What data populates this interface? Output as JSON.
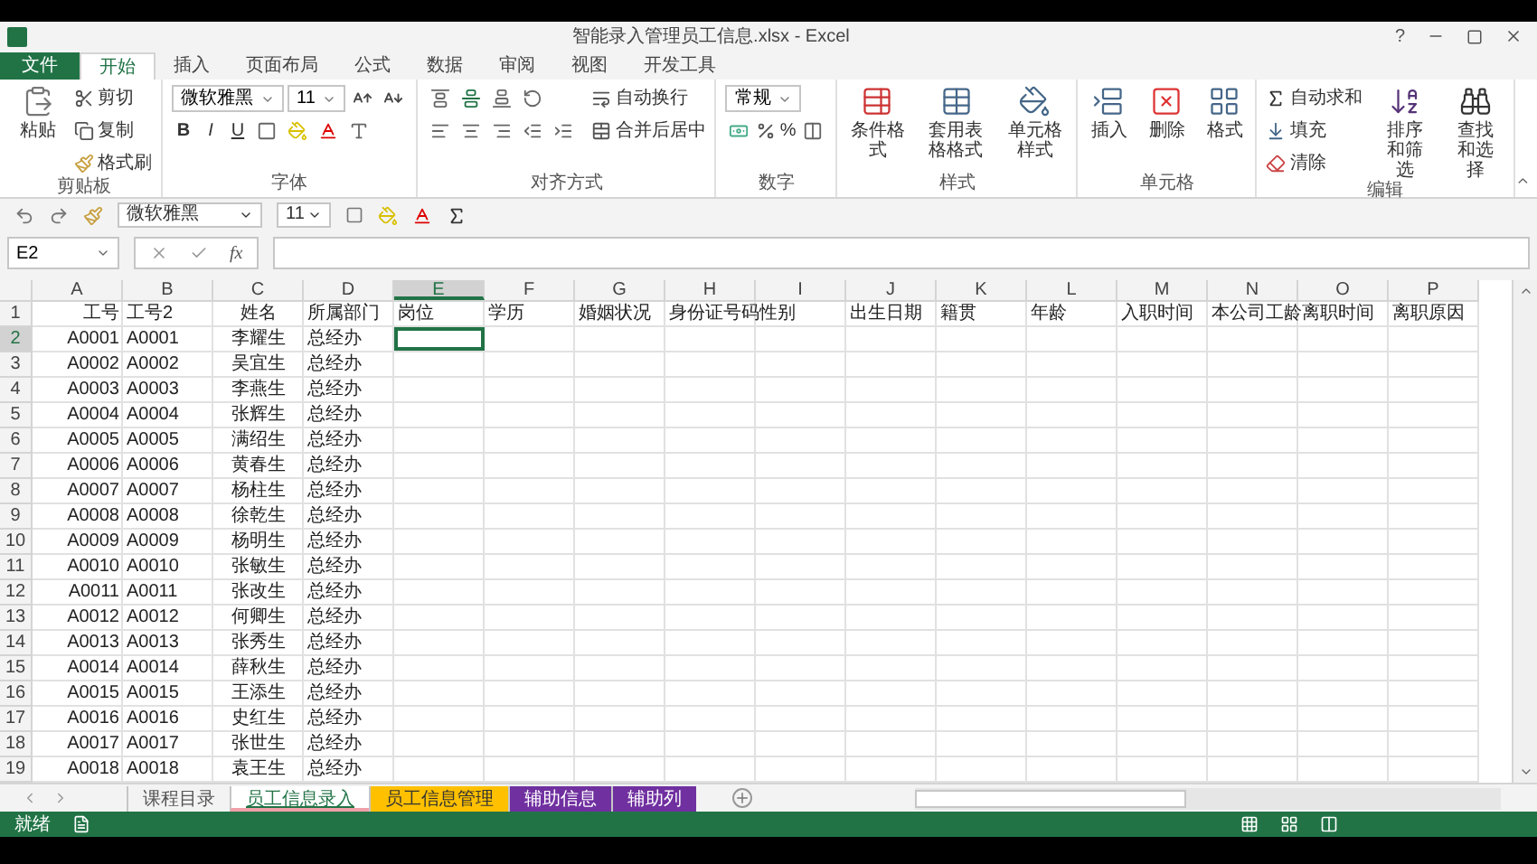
{
  "window": {
    "title": "智能录入管理员工信息.xlsx - Excel",
    "help": "?"
  },
  "ribbon_tabs": [
    {
      "label": "文件",
      "kind": "file",
      "selected": false
    },
    {
      "label": "开始",
      "kind": "tab",
      "selected": true
    },
    {
      "label": "插入",
      "kind": "tab",
      "selected": false
    },
    {
      "label": "页面布局",
      "kind": "tab",
      "selected": false
    },
    {
      "label": "公式",
      "kind": "tab",
      "selected": false
    },
    {
      "label": "数据",
      "kind": "tab",
      "selected": false
    },
    {
      "label": "审阅",
      "kind": "tab",
      "selected": false
    },
    {
      "label": "视图",
      "kind": "tab",
      "selected": false
    },
    {
      "label": "开发工具",
      "kind": "tab",
      "selected": false
    }
  ],
  "ribbon_groups": [
    {
      "label": "剪贴板",
      "columns": [
        [
          [
            {
              "kind": "paste",
              "label": "粘贴"
            }
          ]
        ],
        [
          [
            {
              "kind": "cut",
              "label": "剪切"
            }
          ],
          [
            {
              "kind": "copy",
              "label": "复制"
            }
          ],
          [
            {
              "kind": "painter",
              "label": "格式刷"
            }
          ]
        ]
      ]
    },
    {
      "label": "字体",
      "columns": [
        [
          [
            {
              "kind": "select",
              "label": "微软雅黑"
            },
            {
              "kind": "select",
              "label": "11"
            },
            {
              "kind": "grow"
            },
            {
              "kind": "shrink"
            }
          ],
          [
            {
              "kind": "bold",
              "label": "B"
            },
            {
              "kind": "italic",
              "label": "I"
            },
            {
              "kind": "underline",
              "label": "U"
            },
            {
              "kind": "border"
            },
            {
              "kind": "fill"
            },
            {
              "kind": "fontcolor"
            },
            {
              "kind": "phonetic"
            }
          ]
        ]
      ]
    },
    {
      "label": "对齐方式",
      "columns": [
        [
          [
            {
              "kind": "top"
            },
            {
              "kind": "middle"
            },
            {
              "kind": "bottom"
            },
            {
              "kind": "orient"
            }
          ],
          [
            {
              "kind": "left"
            },
            {
              "kind": "center"
            },
            {
              "kind": "right"
            },
            {
              "kind": "outdent"
            },
            {
              "kind": "indent"
            }
          ]
        ],
        [
          [
            {
              "kind": "wrap",
              "label": "自动换行"
            }
          ],
          [
            {
              "kind": "merge",
              "label": "合并后居中"
            }
          ]
        ]
      ]
    },
    {
      "label": "数字",
      "columns": [
        [
          [
            {
              "kind": "select",
              "label": "常规"
            }
          ],
          [
            {
              "kind": "currency"
            },
            {
              "kind": "percent",
              "label": "%"
            },
            {
              "kind": "decimal"
            }
          ]
        ]
      ]
    },
    {
      "label": "样式",
      "columns": [
        [
          [
            {
              "kind": "conditional",
              "label": "条件格式"
            }
          ]
        ],
        [
          [
            {
              "kind": "table",
              "label": "套用表格格式"
            }
          ]
        ],
        [
          [
            {
              "kind": "cellstyle",
              "label": "单元格样式"
            }
          ]
        ]
      ]
    },
    {
      "label": "单元格",
      "columns": [
        [
          [
            {
              "kind": "insert",
              "label": "插入"
            }
          ]
        ],
        [
          [
            {
              "kind": "delete",
              "label": "删除"
            }
          ]
        ],
        [
          [
            {
              "kind": "format",
              "label": "格式"
            }
          ]
        ]
      ]
    },
    {
      "label": "编辑",
      "columns": [
        [
          [
            {
              "kind": "sum",
              "label": "自动求和"
            }
          ],
          [
            {
              "kind": "filldown",
              "label": "填充"
            }
          ],
          [
            {
              "kind": "clear",
              "label": "清除"
            }
          ]
        ],
        [
          [
            {
              "kind": "sort",
              "label": "排序和筛选"
            }
          ]
        ],
        [
          [
            {
              "kind": "find",
              "label": "查找和选择"
            }
          ]
        ]
      ]
    }
  ],
  "quick_access": {
    "font": "微软雅黑",
    "size": "11"
  },
  "formula_bar": {
    "name_box": "E2",
    "function_label": "fx"
  },
  "columns": [
    {
      "letter": "A",
      "selected": false
    },
    {
      "letter": "B",
      "selected": false
    },
    {
      "letter": "C",
      "selected": false
    },
    {
      "letter": "D",
      "selected": false
    },
    {
      "letter": "E",
      "selected": true
    },
    {
      "letter": "F",
      "selected": false
    },
    {
      "letter": "G",
      "selected": false
    },
    {
      "letter": "H",
      "selected": false
    },
    {
      "letter": "I",
      "selected": false
    },
    {
      "letter": "J",
      "selected": false
    },
    {
      "letter": "K",
      "selected": false
    },
    {
      "letter": "L",
      "selected": false
    },
    {
      "letter": "M",
      "selected": false
    },
    {
      "letter": "N",
      "selected": false
    },
    {
      "letter": "O",
      "selected": false
    },
    {
      "letter": "P",
      "selected": false
    }
  ],
  "rows": [
    {
      "number": "1",
      "selected": false,
      "cells": [
        "工号",
        "工号2",
        "姓名",
        "所属部门",
        "岗位",
        "学历",
        "婚姻状况",
        "身份证号码",
        "性别",
        "出生日期",
        "籍贯",
        "年龄",
        "入职时间",
        "本公司工龄",
        "离职时间",
        "离职原因"
      ]
    },
    {
      "number": "2",
      "selected": true,
      "cells": [
        "A0001",
        "A0001",
        "李耀生",
        "总经办"
      ]
    },
    {
      "number": "3",
      "selected": false,
      "cells": [
        "A0002",
        "A0002",
        "吴宜生",
        "总经办"
      ]
    },
    {
      "number": "4",
      "selected": false,
      "cells": [
        "A0003",
        "A0003",
        "李燕生",
        "总经办"
      ]
    },
    {
      "number": "5",
      "selected": false,
      "cells": [
        "A0004",
        "A0004",
        "张辉生",
        "总经办"
      ]
    },
    {
      "number": "6",
      "selected": false,
      "cells": [
        "A0005",
        "A0005",
        "满绍生",
        "总经办"
      ]
    },
    {
      "number": "7",
      "selected": false,
      "cells": [
        "A0006",
        "A0006",
        "黄春生",
        "总经办"
      ]
    },
    {
      "number": "8",
      "selected": false,
      "cells": [
        "A0007",
        "A0007",
        "杨柱生",
        "总经办"
      ]
    },
    {
      "number": "9",
      "selected": false,
      "cells": [
        "A0008",
        "A0008",
        "徐乾生",
        "总经办"
      ]
    },
    {
      "number": "10",
      "selected": false,
      "cells": [
        "A0009",
        "A0009",
        "杨明生",
        "总经办"
      ]
    },
    {
      "number": "11",
      "selected": false,
      "cells": [
        "A0010",
        "A0010",
        "张敏生",
        "总经办"
      ]
    },
    {
      "number": "12",
      "selected": false,
      "cells": [
        "A0011",
        "A0011",
        "张改生",
        "总经办"
      ]
    },
    {
      "number": "13",
      "selected": false,
      "cells": [
        "A0012",
        "A0012",
        "何卿生",
        "总经办"
      ]
    },
    {
      "number": "14",
      "selected": false,
      "cells": [
        "A0013",
        "A0013",
        "张秀生",
        "总经办"
      ]
    },
    {
      "number": "15",
      "selected": false,
      "cells": [
        "A0014",
        "A0014",
        "薛秋生",
        "总经办"
      ]
    },
    {
      "number": "16",
      "selected": false,
      "cells": [
        "A0015",
        "A0015",
        "王添生",
        "总经办"
      ]
    },
    {
      "number": "17",
      "selected": false,
      "cells": [
        "A0016",
        "A0016",
        "史红生",
        "总经办"
      ]
    },
    {
      "number": "18",
      "selected": false,
      "cells": [
        "A0017",
        "A0017",
        "张世生",
        "总经办"
      ]
    },
    {
      "number": "19",
      "selected": false,
      "cells": [
        "A0018",
        "A0018",
        "袁王生",
        "总经办"
      ]
    }
  ],
  "sheet_tabs": [
    {
      "label": "课程目录",
      "selected": false
    },
    {
      "label": "员工信息录入",
      "selected": true
    },
    {
      "label": "员工信息管理",
      "selected": false,
      "color": "#ffc000"
    },
    {
      "label": "辅助信息",
      "selected": false,
      "color": "#7030a0"
    },
    {
      "label": "辅助列",
      "selected": false,
      "color": "#7030a0"
    }
  ],
  "status_bar": {
    "status": "就绪"
  }
}
